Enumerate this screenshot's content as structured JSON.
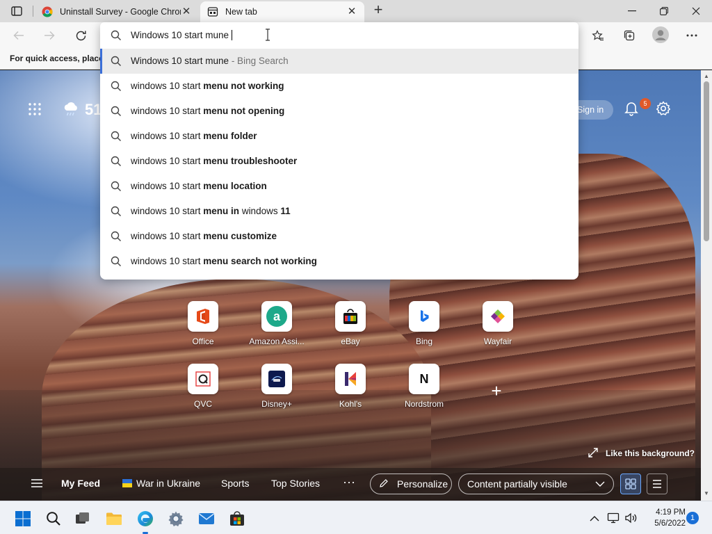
{
  "browser": {
    "tabs": [
      {
        "title": "Uninstall Survey - Google Chrome",
        "icon": "chrome-icon",
        "active": false
      },
      {
        "title": "New tab",
        "icon": "new-tab-page-icon",
        "active": true
      }
    ],
    "favorites_bar_text": "For quick access, place y"
  },
  "address_bar": {
    "value": "Windows 10 start mune",
    "suggestions": [
      {
        "plain": "Windows 10 start mune",
        "bold": "",
        "plain2": "",
        "bold2": "",
        "hint": " - Bing Search"
      },
      {
        "plain": "windows 10 start ",
        "bold": "menu not working",
        "plain2": "",
        "bold2": "",
        "hint": ""
      },
      {
        "plain": "windows 10 start ",
        "bold": "menu not opening",
        "plain2": "",
        "bold2": "",
        "hint": ""
      },
      {
        "plain": "windows 10 start ",
        "bold": "menu folder",
        "plain2": "",
        "bold2": "",
        "hint": ""
      },
      {
        "plain": "windows 10 start ",
        "bold": "menu troubleshooter",
        "plain2": "",
        "bold2": "",
        "hint": ""
      },
      {
        "plain": "windows 10 start ",
        "bold": "menu location",
        "plain2": "",
        "bold2": "",
        "hint": ""
      },
      {
        "plain": "windows 10 start ",
        "bold": "menu in",
        "plain2": " windows ",
        "bold2": "11",
        "hint": ""
      },
      {
        "plain": "windows 10 start ",
        "bold": "menu customize",
        "plain2": "",
        "bold2": "",
        "hint": ""
      },
      {
        "plain": "windows 10 start ",
        "bold": "menu search not working",
        "plain2": "",
        "bold2": "",
        "hint": ""
      }
    ]
  },
  "new_tab_page": {
    "weather_temp": "51",
    "sign_in": "Sign in",
    "notification_count": "5",
    "quick_links": [
      {
        "label": "Office",
        "icon": "office-icon"
      },
      {
        "label": "Amazon Assi...",
        "icon": "amazon-icon"
      },
      {
        "label": "eBay",
        "icon": "ebay-icon"
      },
      {
        "label": "Bing",
        "icon": "bing-icon"
      },
      {
        "label": "Wayfair",
        "icon": "wayfair-icon"
      },
      {
        "label": "QVC",
        "icon": "qvc-icon"
      },
      {
        "label": "Disney+",
        "icon": "disney-icon"
      },
      {
        "label": "Kohl's",
        "icon": "kohls-icon"
      },
      {
        "label": "Nordstrom",
        "icon": "nordstrom-icon"
      }
    ],
    "like_background": "Like this background?",
    "feed": {
      "my_feed": "My Feed",
      "war_in_ukraine": "War in Ukraine",
      "sports": "Sports",
      "top_stories": "Top Stories",
      "more": "···",
      "personalize": "Personalize",
      "content_visibility": "Content partially visible"
    }
  },
  "taskbar": {
    "time": "4:19 PM",
    "date": "5/6/2022",
    "notification_count": "1"
  },
  "colors": {
    "accent": "#1a6fd6",
    "selected_suggestion_bar": "#3b6fd8",
    "notification_badge": "#e0592a"
  }
}
